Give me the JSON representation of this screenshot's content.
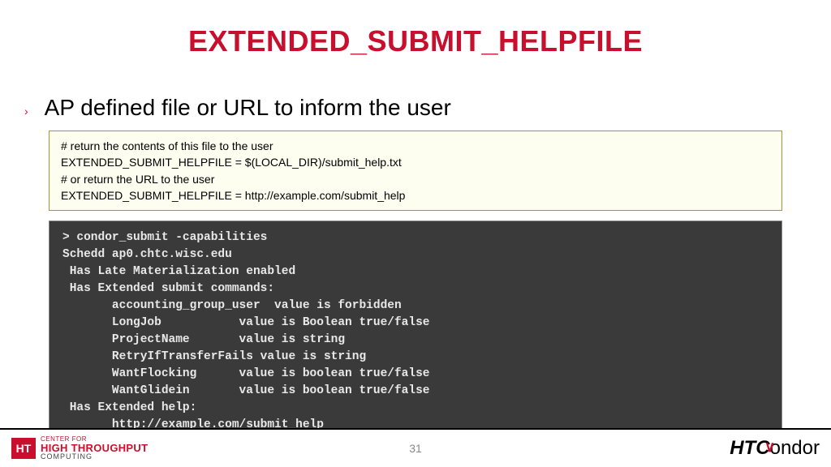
{
  "title": "EXTENDED_SUBMIT_HELPFILE",
  "bullet": {
    "marker": "›",
    "text": "AP defined file or URL to inform the user"
  },
  "config": {
    "l1": "# return the contents of this file to the user",
    "l2": "EXTENDED_SUBMIT_HELPFILE = $(LOCAL_DIR)/submit_help.txt",
    "l3": "# or return the URL to the user",
    "l4": "EXTENDED_SUBMIT_HELPFILE = http://example.com/submit_help"
  },
  "terminal": {
    "l1": "> condor_submit -capabilities",
    "l2": "Schedd ap0.chtc.wisc.edu",
    "l3": " Has Late Materialization enabled",
    "l4": " Has Extended submit commands:",
    "l5": "       accounting_group_user  value is forbidden",
    "l6": "       LongJob           value is Boolean true/false",
    "l7": "       ProjectName       value is string",
    "l8": "       RetryIfTransferFails value is string",
    "l9": "       WantFlocking      value is boolean true/false",
    "l10": "       WantGlidein       value is boolean true/false",
    "l11": " Has Extended help:",
    "l12": "       http://example.com/submit_help"
  },
  "footer": {
    "ht_box": "HT",
    "chtc_top": "CENTER FOR",
    "chtc_mid": "HIGH THROUGHPUT",
    "chtc_low": "COMPUTING",
    "page": "31",
    "condor_ht": "HTC",
    "condor_rest": "ondor",
    "wing": "∨"
  }
}
